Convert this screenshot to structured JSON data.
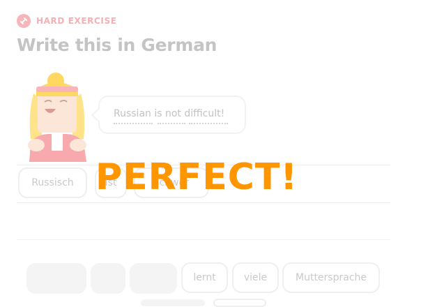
{
  "header": {
    "tag_label": "HARD EXERCISE",
    "tag_icon": "dumbbell-icon",
    "title": "Write this in German"
  },
  "prompt": {
    "text": "Russian is not difficult!",
    "character": "speaking-character-illustration"
  },
  "answer_chips": [
    {
      "label": "Russisch"
    },
    {
      "label": "ist"
    },
    {
      "label": "schwer"
    }
  ],
  "feedback": {
    "text": "PERFECT!",
    "color": "#ff9600"
  },
  "word_bank": {
    "used_slots": 3,
    "chips": [
      {
        "label": "lernt"
      },
      {
        "label": "viele"
      },
      {
        "label": "Muttersprache"
      }
    ]
  },
  "colors": {
    "tag": "#f8aeb3",
    "title": "#c4c4c4",
    "accent": "#ff9600"
  }
}
